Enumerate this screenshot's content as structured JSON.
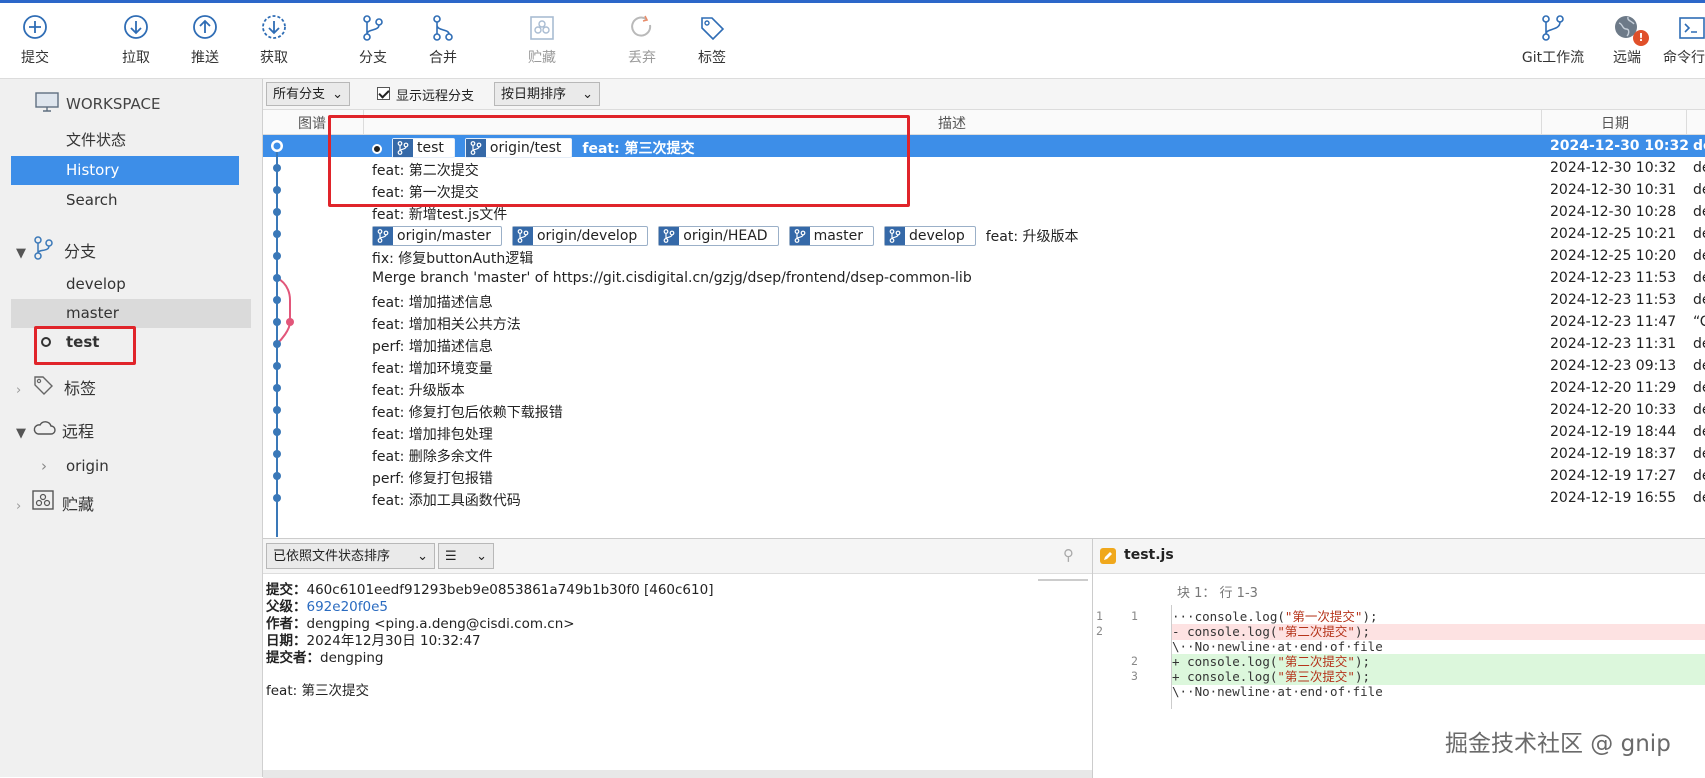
{
  "toolbar": {
    "commit": "提交",
    "pull": "拉取",
    "push": "推送",
    "fetch": "获取",
    "branch": "分支",
    "merge": "合并",
    "stash": "贮藏",
    "discard": "丢弃",
    "tag": "标签",
    "git_flow": "Git工作流",
    "remote": "远端",
    "terminal": "命令行",
    "remote_badge": "!"
  },
  "sidebar": {
    "workspace": "WORKSPACE",
    "file_status": "文件状态",
    "history": "History",
    "search": "Search",
    "branches": "分支",
    "branch_items": [
      "develop",
      "master",
      "test"
    ],
    "tags": "标签",
    "remotes": "远程",
    "remote_items": [
      "origin"
    ],
    "stashes": "贮藏"
  },
  "filter": {
    "all_branches": "所有分支",
    "show_remote": "显示远程分支",
    "sort_by_date": "按日期排序"
  },
  "columns": {
    "graph": "图谱",
    "description": "描述",
    "date": "日期"
  },
  "commits": [
    {
      "tags": [
        "test",
        "origin/test"
      ],
      "msg": "feat: 第三次提交",
      "date": "2024-12-30 10:32",
      "author": "de"
    },
    {
      "tags": [],
      "msg": "feat: 第二次提交",
      "date": "2024-12-30 10:32",
      "author": "de"
    },
    {
      "tags": [],
      "msg": "feat: 第一次提交",
      "date": "2024-12-30 10:31",
      "author": "de"
    },
    {
      "tags": [],
      "msg": "feat: 新增test.js文件",
      "date": "2024-12-30 10:28",
      "author": "de"
    },
    {
      "tags": [
        "origin/master",
        "origin/develop",
        "origin/HEAD",
        "master",
        "develop"
      ],
      "msg": "feat: 升级版本",
      "date": "2024-12-25 10:21",
      "author": "de"
    },
    {
      "tags": [],
      "msg": "fix: 修复buttonAuth逻辑",
      "date": "2024-12-25 10:20",
      "author": "de"
    },
    {
      "tags": [],
      "msg": "Merge branch 'master' of https://git.cisdigital.cn/gzjg/dsep/frontend/dsep-common-lib",
      "date": "2024-12-23 11:53",
      "author": "de"
    },
    {
      "tags": [],
      "msg": "feat: 增加描述信息",
      "date": "2024-12-23 11:53",
      "author": "de"
    },
    {
      "tags": [],
      "msg": "feat: 增加相关公共方法",
      "date": "2024-12-23 11:47",
      "author": "“C"
    },
    {
      "tags": [],
      "msg": "perf: 增加描述信息",
      "date": "2024-12-23 11:31",
      "author": "de"
    },
    {
      "tags": [],
      "msg": "feat: 增加环境变量",
      "date": "2024-12-23 09:13",
      "author": "de"
    },
    {
      "tags": [],
      "msg": "feat: 升级版本",
      "date": "2024-12-20 11:29",
      "author": "de"
    },
    {
      "tags": [],
      "msg": "feat: 修复打包后依赖下载报错",
      "date": "2024-12-20 10:33",
      "author": "de"
    },
    {
      "tags": [],
      "msg": "feat: 增加排包处理",
      "date": "2024-12-19 18:44",
      "author": "de"
    },
    {
      "tags": [],
      "msg": "feat: 删除多余文件",
      "date": "2024-12-19 18:37",
      "author": "de"
    },
    {
      "tags": [],
      "msg": "perf: 修复打包报错",
      "date": "2024-12-19 17:27",
      "author": "de"
    },
    {
      "tags": [],
      "msg": "feat: 添加工具函数代码",
      "date": "2024-12-19 16:55",
      "author": "de"
    }
  ],
  "details": {
    "sort_label": "已依照文件状态排序",
    "commit_label": "提交：",
    "commit_value": "460c6101eedf91293beb9e0853861a749b1b30f0 [460c610]",
    "parent_label": "父级：",
    "parent_value": "692e20f0e5",
    "author_label": "作者：",
    "author_value": "dengping <ping.a.deng@cisdi.com.cn>",
    "date_label": "日期：",
    "date_value": "2024年12月30日 10:32:47",
    "committer_label": "提交者：",
    "committer_value": "dengping",
    "message": "feat: 第三次提交"
  },
  "diff": {
    "filename": "test.js",
    "hunk": "块 1： 行 1-3",
    "lines": [
      {
        "type": "ctx",
        "old": "1",
        "new": "1",
        "prefix": "···",
        "pre": "console.log(",
        "str": "\"第一次提交\"",
        "post": ");"
      },
      {
        "type": "del",
        "old": "2",
        "new": "",
        "prefix": "- ",
        "pre": "console.log(",
        "str": "\"第二次提交\"",
        "post": ");"
      },
      {
        "type": "note",
        "old": "",
        "new": "",
        "prefix": "\\··",
        "pre": "No·newline·at·end·of·file",
        "str": "",
        "post": ""
      },
      {
        "type": "add",
        "old": "",
        "new": "2",
        "prefix": "+ ",
        "pre": "console.log(",
        "str": "\"第二次提交\"",
        "post": ");"
      },
      {
        "type": "add",
        "old": "",
        "new": "3",
        "prefix": "+ ",
        "pre": "console.log(",
        "str": "\"第三次提交\"",
        "post": ");"
      },
      {
        "type": "note",
        "old": "",
        "new": "",
        "prefix": "\\··",
        "pre": "No·newline·at·end·of·file",
        "str": "",
        "post": ""
      }
    ]
  },
  "watermark": "掘金技术社区 @ gnip",
  "colors": {
    "accent": "#3d8ee8",
    "highlight": "#e0242a",
    "graph_blue": "#3a78b8",
    "graph_pink": "#e2567a"
  }
}
